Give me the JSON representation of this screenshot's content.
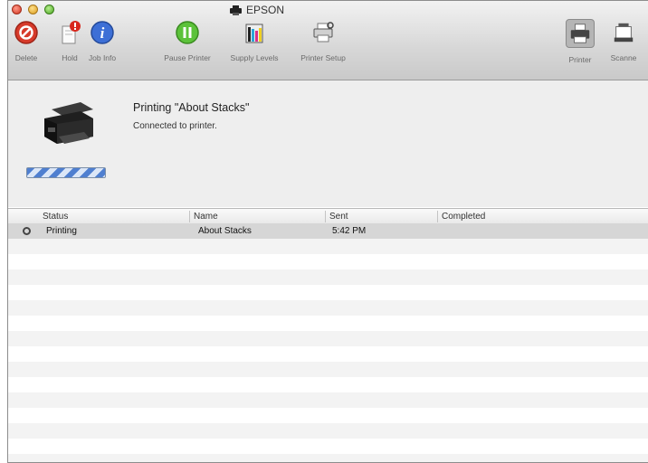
{
  "window": {
    "title": "EPSON"
  },
  "toolbar": {
    "items": [
      {
        "label": "Delete",
        "icon": "delete-icon"
      },
      {
        "label": "Hold",
        "icon": "hold-icon"
      },
      {
        "label": "Job Info",
        "icon": "info-icon"
      },
      {
        "label": "Pause Printer",
        "icon": "pause-icon"
      },
      {
        "label": "Supply Levels",
        "icon": "supply-levels-icon"
      },
      {
        "label": "Printer Setup",
        "icon": "printer-setup-icon"
      },
      {
        "label": "Printer",
        "icon": "printer-icon"
      },
      {
        "label": "Scanne",
        "icon": "scanner-icon"
      }
    ]
  },
  "job": {
    "title": "Printing \"About Stacks\"",
    "status": "Connected to printer."
  },
  "table": {
    "columns": [
      "Status",
      "Name",
      "Sent",
      "Completed"
    ],
    "rows": [
      {
        "status": "Printing",
        "name": "About Stacks",
        "sent": "5:42 PM",
        "completed": ""
      }
    ]
  },
  "colors": {
    "selected_row": "#d6d6d6",
    "progress": "#4f7fd0"
  }
}
